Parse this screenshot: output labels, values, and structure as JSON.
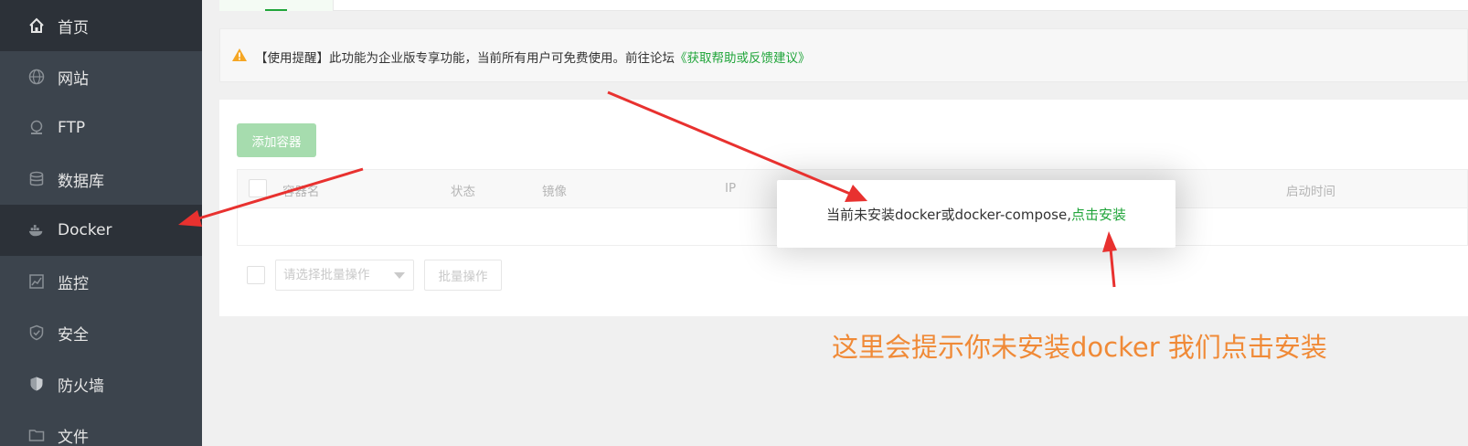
{
  "sidebar": {
    "items": [
      {
        "label": "首页",
        "icon": "home-icon"
      },
      {
        "label": "网站",
        "icon": "globe-icon"
      },
      {
        "label": "FTP",
        "icon": "ftp-icon"
      },
      {
        "label": "数据库",
        "icon": "database-icon"
      },
      {
        "label": "Docker",
        "icon": "docker-icon"
      },
      {
        "label": "监控",
        "icon": "monitor-icon"
      },
      {
        "label": "安全",
        "icon": "shield-check-icon"
      },
      {
        "label": "防火墙",
        "icon": "firewall-shield-icon"
      },
      {
        "label": "文件",
        "icon": "folder-icon"
      }
    ],
    "active": "Docker"
  },
  "notice": {
    "text": "【使用提醒】此功能为企业版专享功能，当前所有用户可免费使用。前往论坛",
    "link": "《获取帮助或反馈建议》"
  },
  "toolbar": {
    "add_container_label": "添加容器"
  },
  "table": {
    "columns": [
      "容器名",
      "状态",
      "镜像",
      "IP",
      "启动时间"
    ]
  },
  "batch": {
    "select_placeholder": "请选择批量操作",
    "button_label": "批量操作"
  },
  "popup": {
    "message": "当前未安装docker或docker-compose,",
    "install_link": "点击安装"
  },
  "annotation": {
    "text": "这里会提示你未安装docker 我们点击安装"
  },
  "colors": {
    "sidebar_bg": "#3c444d",
    "accent_green": "#20a53a",
    "annotation_orange": "#f08a37",
    "arrow_red": "#e8312f"
  }
}
